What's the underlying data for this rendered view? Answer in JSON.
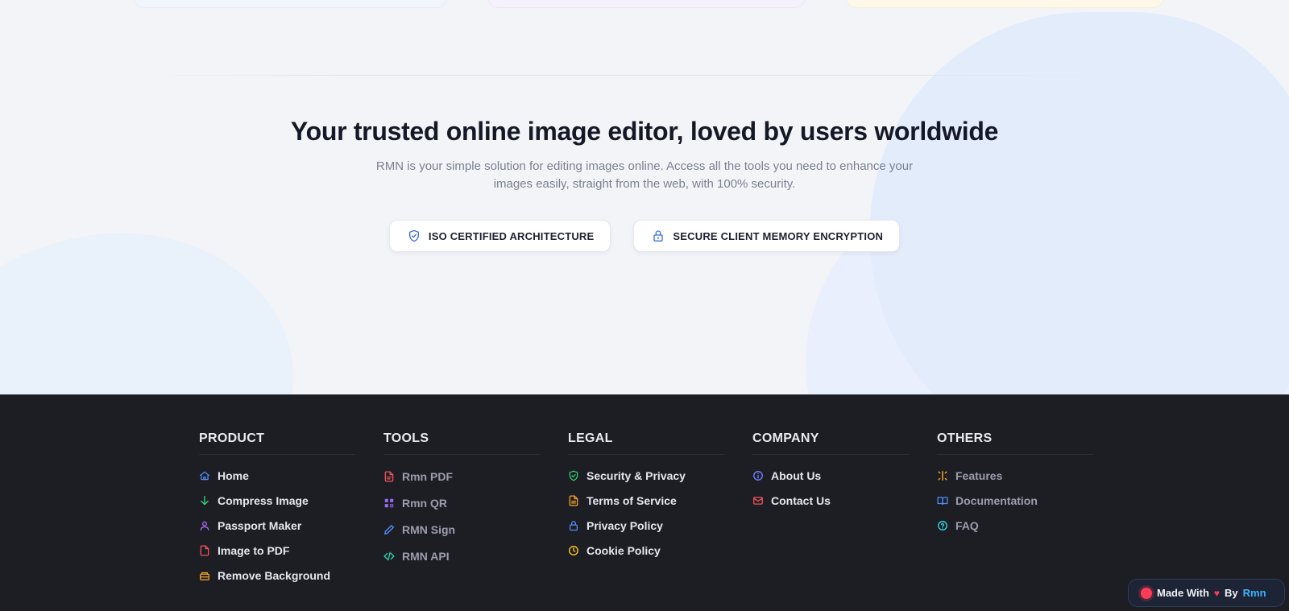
{
  "hero": {
    "title": "Your trusted online image editor, loved by users worldwide",
    "description": "RMN is your simple solution for editing images online. Access all the tools you need to enhance your images easily, straight from the web, with 100% security."
  },
  "badges": [
    {
      "label": "ISO CERTIFIED ARCHITECTURE",
      "icon": "shield-check-icon",
      "color": "#3b6fd8"
    },
    {
      "label": "SECURE CLIENT MEMORY ENCRYPTION",
      "icon": "lock-icon",
      "color": "#3b6fd8"
    }
  ],
  "footer": {
    "product": {
      "title": "PRODUCT",
      "items": [
        {
          "label": "Home",
          "icon": "home-icon",
          "color": "#4f8ef7"
        },
        {
          "label": "Compress Image",
          "icon": "arrow-down-icon",
          "color": "#2fcf73"
        },
        {
          "label": "Passport Maker",
          "icon": "user-icon",
          "color": "#b36af7"
        },
        {
          "label": "Image to PDF",
          "icon": "file-icon",
          "color": "#f2545b"
        },
        {
          "label": "Remove Background",
          "icon": "layers-icon",
          "color": "#f5a524"
        }
      ]
    },
    "tools": {
      "title": "TOOLS",
      "items": [
        {
          "label": "Rmn PDF",
          "icon": "pdf-file-icon",
          "color": "#f2545b"
        },
        {
          "label": "Rmn QR",
          "icon": "qr-code-icon",
          "color": "#9b6af7"
        },
        {
          "label": "RMN Sign",
          "icon": "pen-icon",
          "color": "#4f8ef7"
        },
        {
          "label": "RMN API",
          "icon": "code-icon",
          "color": "#2fcfa8"
        }
      ]
    },
    "legal": {
      "title": "LEGAL",
      "items": [
        {
          "label": "Security & Privacy",
          "icon": "shield-check-icon",
          "color": "#2fcf73"
        },
        {
          "label": "Terms of Service",
          "icon": "document-icon",
          "color": "#f5a524"
        },
        {
          "label": "Privacy Policy",
          "icon": "lock-icon",
          "color": "#4f8ef7"
        },
        {
          "label": "Cookie Policy",
          "icon": "clock-icon",
          "color": "#f5c518"
        }
      ]
    },
    "company": {
      "title": "COMPANY",
      "items": [
        {
          "label": "About Us",
          "icon": "info-icon",
          "color": "#6c7cf7"
        },
        {
          "label": "Contact Us",
          "icon": "mail-icon",
          "color": "#f2545b"
        }
      ]
    },
    "others": {
      "title": "OTHERS",
      "items": [
        {
          "label": "Features",
          "icon": "sparkle-icon",
          "color": "#f5a524"
        },
        {
          "label": "Documentation",
          "icon": "book-icon",
          "color": "#4f8ef7"
        },
        {
          "label": "FAQ",
          "icon": "help-circle-icon",
          "color": "#2fcfd8"
        }
      ]
    }
  },
  "made_with": {
    "prefix": "Made With",
    "heart": "♥",
    "by": "By",
    "brand": "Rmn"
  }
}
